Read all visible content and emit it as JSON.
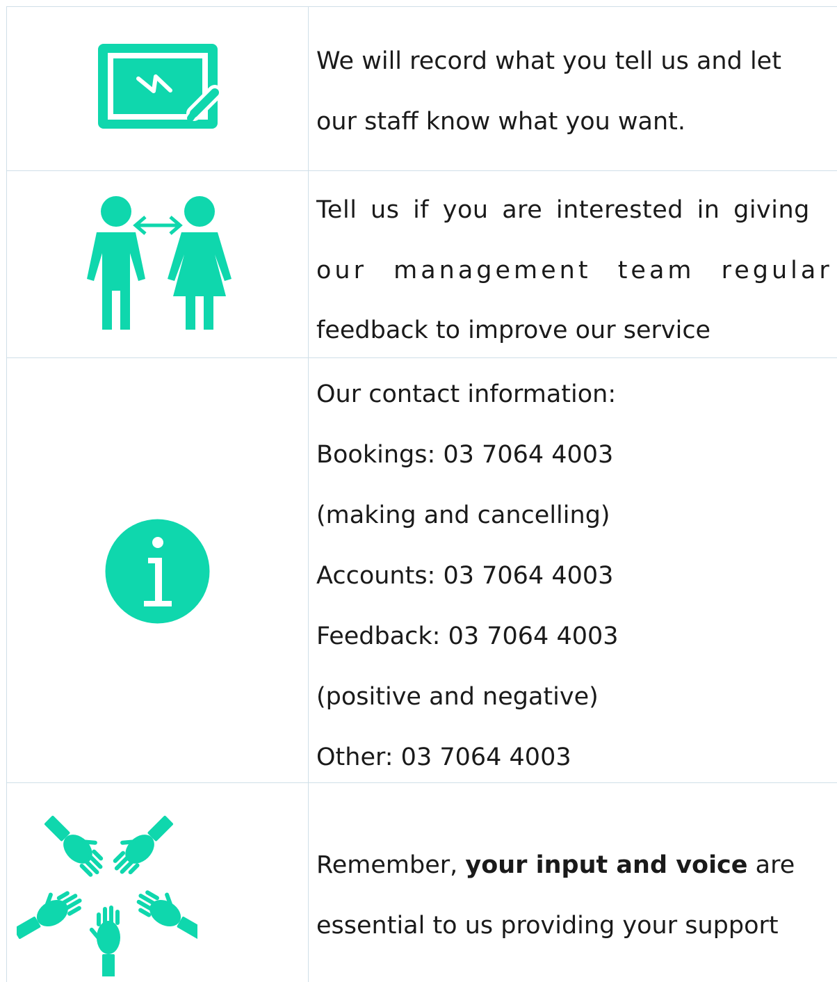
{
  "theme": {
    "accent": "#0fd7ad",
    "border": "#cfdfe8",
    "text": "#1a1a1a"
  },
  "rows": [
    {
      "icon": "whiteboard-icon",
      "lines": [
        "We will record what you tell us and let",
        "our staff know what you want."
      ]
    },
    {
      "icon": "people-exchange-icon",
      "lines": [
        "Tell us if you are interested in giving",
        "our management team regular",
        "feedback to improve our service"
      ]
    },
    {
      "icon": "information-icon",
      "lines": [
        "Our contact information:",
        "Bookings: 03 7064 4003",
        "(making and cancelling)",
        "Accounts: 03 7064 4003",
        "Feedback: 03 7064 4003",
        "(positive and negative)",
        "Other: 03 7064 4003"
      ]
    },
    {
      "icon": "hands-together-icon",
      "lines_parts": {
        "prefix": "Remember, ",
        "bold": "your input and voice",
        "suffix": " are"
      },
      "lines": [
        "essential to us providing your support"
      ]
    }
  ]
}
